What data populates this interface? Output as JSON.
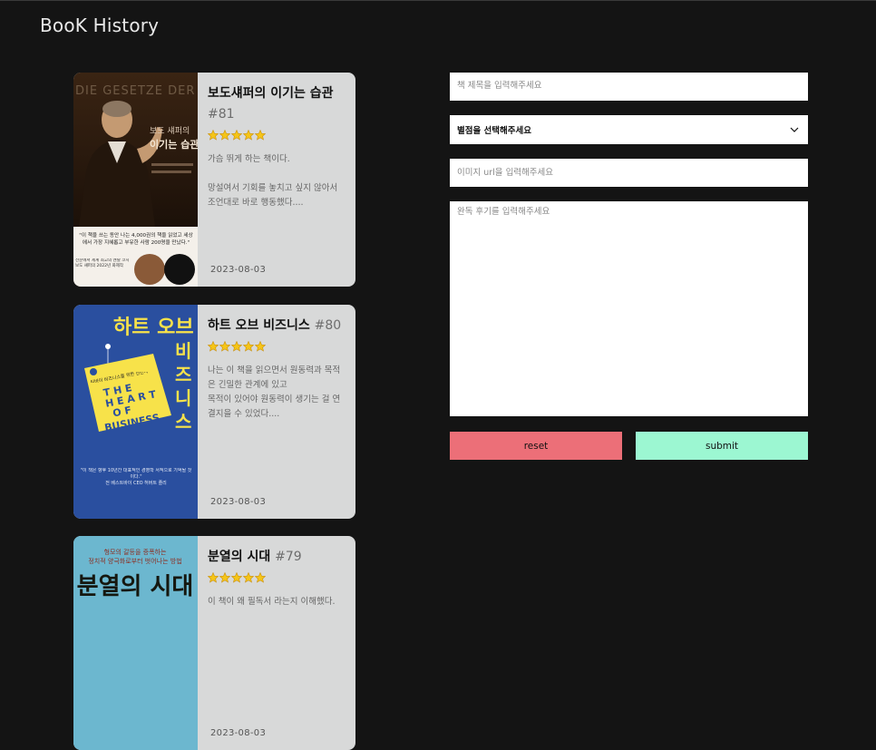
{
  "app": {
    "title": "BooK History"
  },
  "books": [
    {
      "title": "보도섀퍼의 이기는 습관",
      "number": "#81",
      "rating": 5,
      "review": "가슴 뛰게 하는 책이다.\n\n망설여서 기회를 놓치고 싶지 않아서 조언대로 바로 행동했다....",
      "date": "2023-08-03",
      "cover": {
        "bg": "#2a1a0e",
        "text_top": "DIE GESETZE DER GEWINNER",
        "author_line": "보도 섀퍼의",
        "title_line": "이기는 습관",
        "blurb": "\"이 책을 쓰는 동안 나는 4,000권의 책을 읽었고 세상에서 가장 지혜롭고 부유한 사람 200명을 만났다.\"",
        "note": "전문에서 세계 최고의 멘탈 코치 보도 섀퍼의 2022년 화제작"
      }
    },
    {
      "title": "하트 오브 비즈니스",
      "number": "#80",
      "rating": 5,
      "review": "나는 이 책을 읽으면서 원동력과 목적은 긴밀한 관계에 있고\n목적이 있어야 원동력이 생기는 걸 연결지을 수 있었다....",
      "date": "2023-08-03",
      "cover": {
        "bg": "#2a4f9f",
        "title_ko": "하트 오브",
        "title_ko2": "비즈니스",
        "tag_line": "티바이 비즈니스를 위한 선언서",
        "tag_en": "THE HEART OF BUSINESS",
        "quote": "\"이 책은 향후 10년간 대표적인 경영학 서적으로 기억될 것이다.\"",
        "footer": "전 베스트바이 CEO 허버트 졸리"
      }
    },
    {
      "title": "분열의 시대",
      "number": "#79",
      "rating": 5,
      "review": "이 책이 왜 필독서 라는지 이해했다.",
      "date": "2023-08-03",
      "cover": {
        "bg": "#6cb7cf",
        "top_line": "형모의 갈등을 증폭하는",
        "top_line2": "정치적 양극화로부터 벗어나는 방법",
        "title": "분열의 시대"
      }
    }
  ],
  "form": {
    "title_placeholder": "책 제목을 입력해주세요",
    "rating_placeholder": "별점을 선택해주세요",
    "image_placeholder": "이미지 url을 입력해주세요",
    "review_placeholder": "완독 후기를 입력해주세요",
    "reset_label": "reset",
    "submit_label": "submit"
  },
  "colors": {
    "background": "#141414",
    "card": "#d8d9d9",
    "reset": "#ec6f78",
    "submit": "#9cf7d2",
    "star": "#f5c518"
  }
}
